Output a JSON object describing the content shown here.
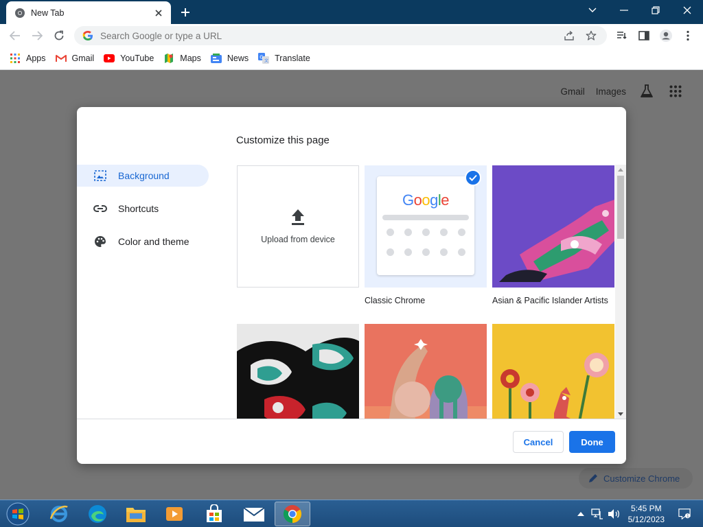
{
  "browser": {
    "tab_title": "New Tab",
    "omnibox_placeholder": "Search Google or type a URL",
    "bookmarks": [
      {
        "label": "Apps",
        "icon": "apps-grid-icon"
      },
      {
        "label": "Gmail",
        "icon": "gmail-icon"
      },
      {
        "label": "YouTube",
        "icon": "youtube-icon"
      },
      {
        "label": "Maps",
        "icon": "maps-icon"
      },
      {
        "label": "News",
        "icon": "news-icon"
      },
      {
        "label": "Translate",
        "icon": "translate-icon"
      }
    ]
  },
  "ntp": {
    "gmail_link": "Gmail",
    "images_link": "Images",
    "customize_chrome": "Customize Chrome"
  },
  "dialog": {
    "title": "Customize this page",
    "sidebar": [
      {
        "label": "Background",
        "icon": "background-icon",
        "active": true
      },
      {
        "label": "Shortcuts",
        "icon": "link-icon",
        "active": false
      },
      {
        "label": "Color and theme",
        "icon": "palette-icon",
        "active": false
      }
    ],
    "tiles": [
      {
        "caption": "Upload from device",
        "kind": "upload"
      },
      {
        "caption": "Classic Chrome",
        "kind": "classic",
        "selected": true
      },
      {
        "caption": "Asian & Pacific Islander Artists",
        "kind": "image"
      },
      {
        "caption": "",
        "kind": "image"
      },
      {
        "caption": "",
        "kind": "image"
      },
      {
        "caption": "",
        "kind": "image"
      }
    ],
    "classic_logo": "Google",
    "cancel_label": "Cancel",
    "done_label": "Done"
  },
  "taskbar": {
    "time": "5:45 PM",
    "date": "5/12/2023"
  },
  "colors": {
    "accent": "#1a73e8",
    "titlebar": "#0b3a5f",
    "taskbar": "#1d4c7c"
  }
}
